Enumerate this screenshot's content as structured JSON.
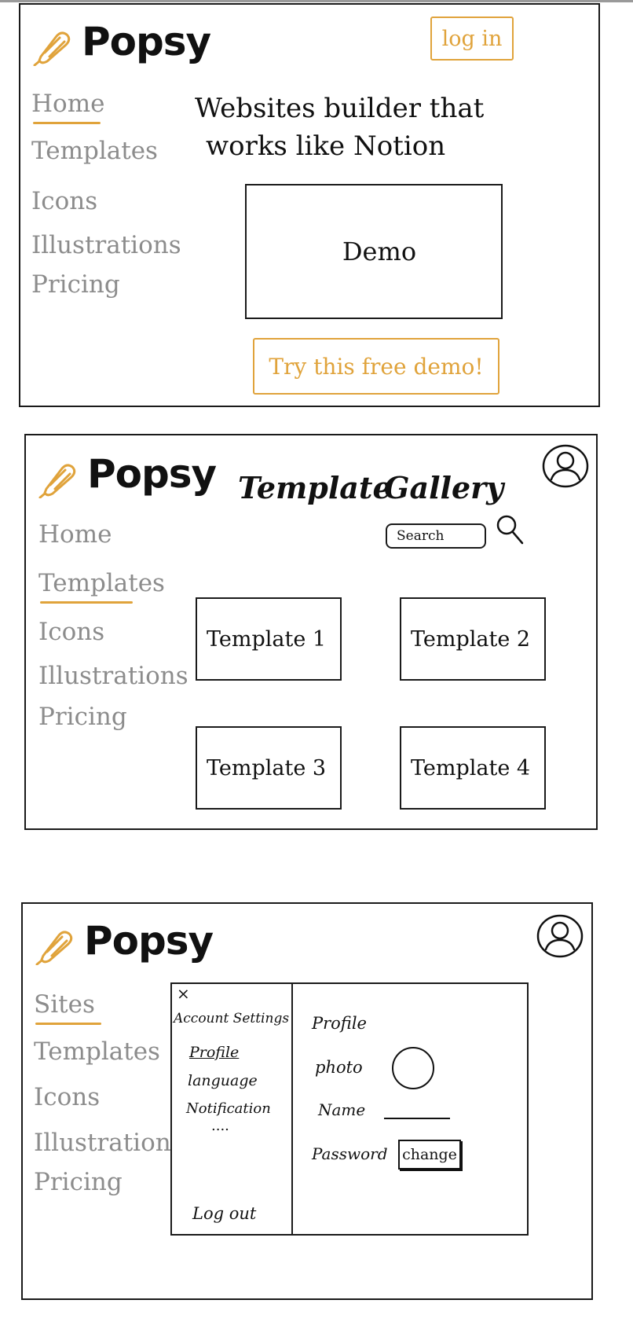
{
  "brand": "Popsy",
  "accent_color": "#e0a33b",
  "screen1": {
    "nav": [
      "Home",
      "Templates",
      "Icons",
      "Illustrations",
      "Pricing"
    ],
    "active_nav": "Home",
    "login_label": "log in",
    "headline_line1": "Websites builder that",
    "headline_line2": "works like Notion",
    "demo_label": "Demo",
    "cta_label": "Try this free demo!"
  },
  "screen2": {
    "nav": [
      "Home",
      "Templates",
      "Icons",
      "Illustrations",
      "Pricing"
    ],
    "active_nav": "Templates",
    "title_part1": "Template",
    "title_part2": "Gallery",
    "search_placeholder": "Search",
    "templates": [
      "Template 1",
      "Template 2",
      "Template 3",
      "Template 4"
    ]
  },
  "screen3": {
    "nav": [
      "Sites",
      "Templates",
      "Icons",
      "Illustrations",
      "Pricing"
    ],
    "active_nav": "Sites",
    "close_label": "×",
    "settings_title": "Account Settings",
    "settings_items": [
      "Profile",
      "language",
      "Notification",
      "...."
    ],
    "logout_label": "Log out",
    "profile_title": "Profile",
    "photo_label": "photo",
    "name_label": "Name",
    "password_label": "Password",
    "change_label": "change"
  }
}
